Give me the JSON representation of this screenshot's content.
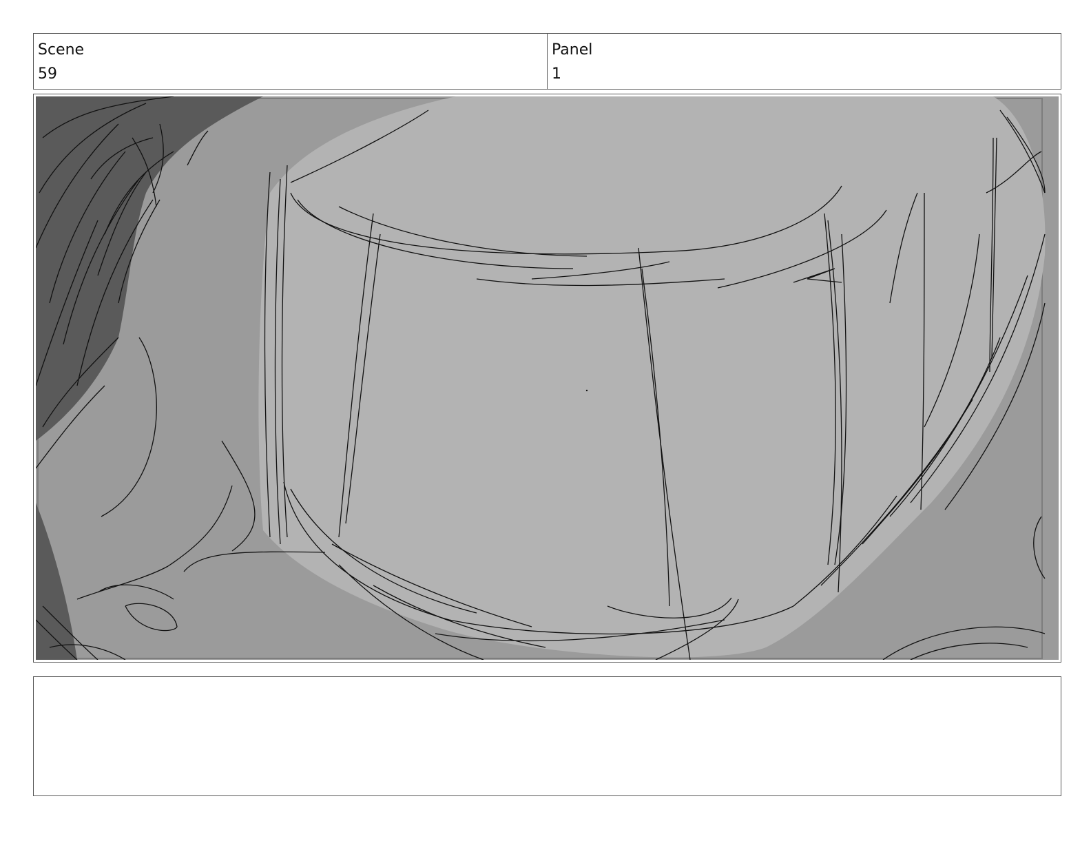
{
  "header": {
    "scene_label": "Scene",
    "scene_value": "59",
    "panel_label": "Panel",
    "panel_value": "1"
  },
  "panel": {
    "image_icon": "storyboard-sketch-icon",
    "colors": {
      "background": "#9b9b9b",
      "highlight": "#b3b3b3",
      "shadow": "#5a5a5a",
      "line": "#111111"
    }
  },
  "notes": {
    "text": ""
  }
}
